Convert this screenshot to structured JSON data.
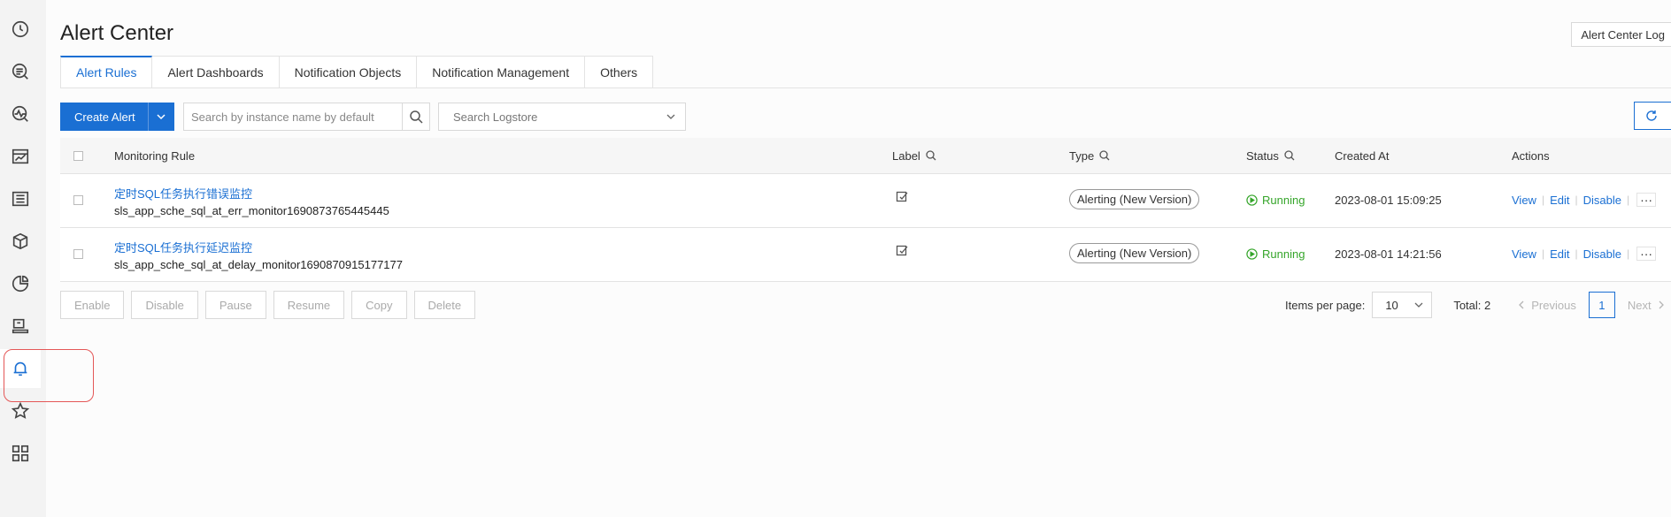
{
  "sidebar": {
    "items": [
      {
        "icon": "clock-icon"
      },
      {
        "icon": "search-log-icon"
      },
      {
        "icon": "monitor-search-icon"
      },
      {
        "icon": "chart-report-icon"
      },
      {
        "icon": "document-list-icon"
      },
      {
        "icon": "box-package-icon"
      },
      {
        "icon": "pie-chart-icon"
      },
      {
        "icon": "inbox-tray-icon"
      },
      {
        "icon": "bell-icon",
        "active": true
      },
      {
        "icon": "star-icon"
      },
      {
        "icon": "grid-apps-icon"
      }
    ]
  },
  "header": {
    "title": "Alert Center",
    "log_button": "Alert Center Log"
  },
  "tabs": [
    {
      "label": "Alert Rules",
      "active": true
    },
    {
      "label": "Alert Dashboards"
    },
    {
      "label": "Notification Objects"
    },
    {
      "label": "Notification Management"
    },
    {
      "label": "Others"
    }
  ],
  "toolbar": {
    "create_label": "Create Alert",
    "search_placeholder": "Search by instance name by default",
    "logstore_placeholder": "Search Logstore"
  },
  "table": {
    "columns": {
      "rule": "Monitoring Rule",
      "label": "Label",
      "type": "Type",
      "status": "Status",
      "created": "Created At",
      "actions": "Actions"
    },
    "rows": [
      {
        "name": "定时SQL任务执行错误监控",
        "id": "sls_app_sche_sql_at_err_monitor1690873765445445",
        "type": "Alerting (New Version)",
        "status": "Running",
        "created": "2023-08-01 15:09:25"
      },
      {
        "name": "定时SQL任务执行延迟监控",
        "id": "sls_app_sche_sql_at_delay_monitor1690870915177177",
        "type": "Alerting (New Version)",
        "status": "Running",
        "created": "2023-08-01 14:21:56"
      }
    ],
    "actions": {
      "view": "View",
      "edit": "Edit",
      "disable": "Disable",
      "more": "···"
    }
  },
  "batch": {
    "enable": "Enable",
    "disable": "Disable",
    "pause": "Pause",
    "resume": "Resume",
    "copy": "Copy",
    "delete": "Delete"
  },
  "pagination": {
    "items_per_page_label": "Items per page:",
    "page_size": "10",
    "total": "Total: 2",
    "previous": "Previous",
    "current_page": "1",
    "next": "Next"
  },
  "colors": {
    "primary": "#1a6fd3",
    "running": "#35a52a",
    "highlight": "#e45757"
  }
}
